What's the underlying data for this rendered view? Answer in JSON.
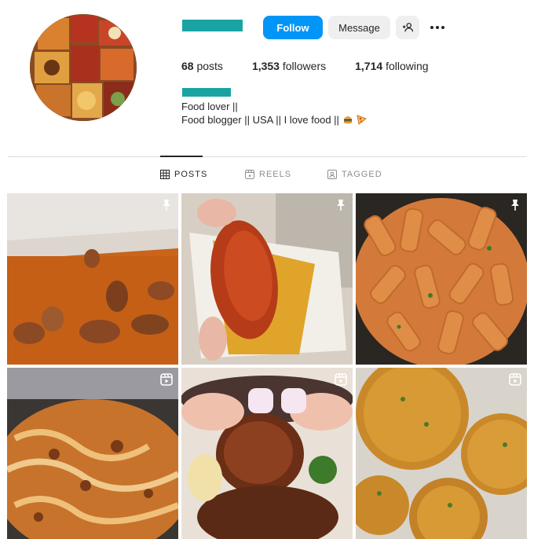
{
  "profile": {
    "buttons": {
      "follow": "Follow",
      "message": "Message"
    },
    "stats": [
      {
        "count": "68",
        "label": "posts"
      },
      {
        "count": "1,353",
        "label": "followers"
      },
      {
        "count": "1,714",
        "label": "following"
      }
    ],
    "bio": {
      "line1": "Food lover ||",
      "line2": "Food blogger || USA || I love food ||"
    }
  },
  "tabs": [
    {
      "label": "POSTS",
      "icon": "grid-icon",
      "active": true
    },
    {
      "label": "REELS",
      "icon": "reels-icon",
      "active": false
    },
    {
      "label": "TAGGED",
      "icon": "tagged-icon",
      "active": false
    }
  ],
  "posts": [
    {
      "subject": "pecans in caramel",
      "badge": "pin-icon"
    },
    {
      "subject": "fried chicken tender",
      "badge": "pin-icon"
    },
    {
      "subject": "rigatoni pasta",
      "badge": "pin-icon"
    },
    {
      "subject": "baked pasta",
      "badge": "reel-icon"
    },
    {
      "subject": "grilled chicken",
      "badge": "reel-icon"
    },
    {
      "subject": "fried croquettes",
      "badge": "reel-icon"
    }
  ],
  "colors": {
    "accent": "#0095f6",
    "redacted": "#1aa3a3",
    "muted": "#8e8e8e"
  }
}
